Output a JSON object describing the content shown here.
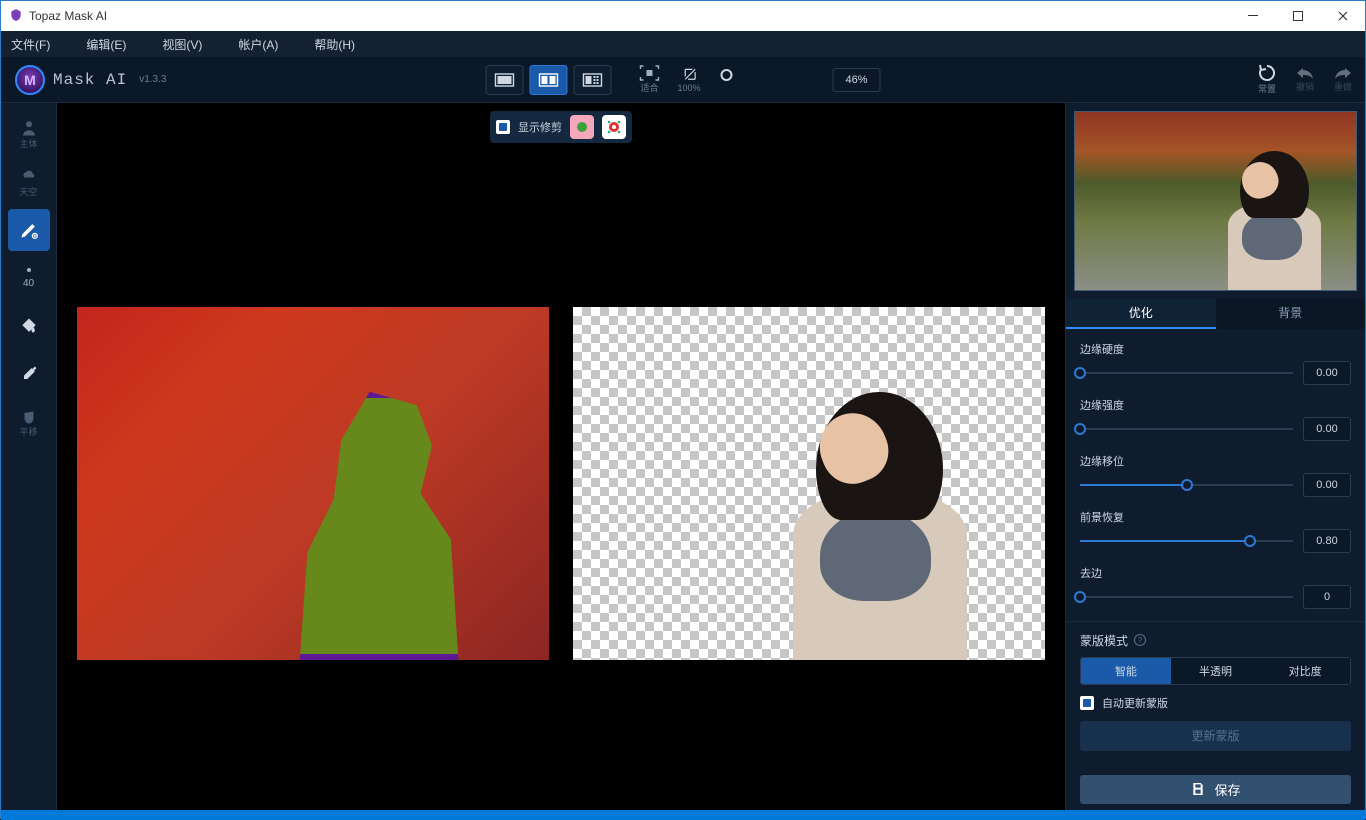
{
  "window": {
    "title": "Topaz Mask AI"
  },
  "menu": {
    "file": "文件(F)",
    "edit": "编辑(E)",
    "view": "视图(V)",
    "account": "帐户(A)",
    "help": "帮助(H)"
  },
  "app": {
    "name": "Mask AI",
    "version": "v1.3.3"
  },
  "toolbar": {
    "zoom_fit": "适合",
    "zoom_100": "100%",
    "zoom_value": "46%",
    "reset": "常置",
    "undo": "撤销",
    "redo": "重做"
  },
  "canvas_bar": {
    "show_trim": "显示修剪"
  },
  "left_tools": {
    "subject": "主体",
    "sky": "天空",
    "brush_size": "40",
    "hand": "平移"
  },
  "tabs": {
    "optimize": "优化",
    "background": "背景"
  },
  "sliders": {
    "edge_hardness": {
      "label": "边缘硬度",
      "value": "0.00",
      "pos": 0
    },
    "edge_strength": {
      "label": "边缘强度",
      "value": "0.00",
      "pos": 0
    },
    "edge_shift": {
      "label": "边缘移位",
      "value": "0.00",
      "pos": 50
    },
    "fg_recover": {
      "label": "前景恢复",
      "value": "0.80",
      "pos": 80
    },
    "defringe": {
      "label": "去边",
      "value": "0",
      "pos": 0
    }
  },
  "mask_mode": {
    "title": "蒙版模式",
    "smart": "智能",
    "semi": "半透明",
    "contrast": "对比度",
    "auto_update": "自动更新蒙版",
    "update_btn": "更新蒙版"
  },
  "save": "保存"
}
